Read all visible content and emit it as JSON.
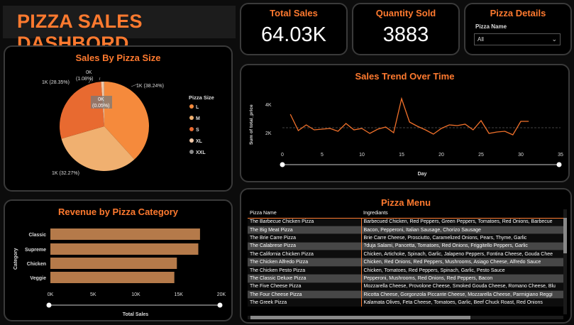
{
  "dashboard": {
    "title": "PIZZA SALES DASHBORD"
  },
  "kpis": {
    "total_sales": {
      "label": "Total Sales",
      "value": "64.03K"
    },
    "quantity_sold": {
      "label": "Quantity Sold",
      "value": "3883"
    }
  },
  "filter": {
    "title": "Pizza Details",
    "field_label": "Pizza Name",
    "selected": "All"
  },
  "size_chart": {
    "title": "Sales By Pizza Size",
    "legend_title": "Pizza Size",
    "sizes": [
      "L",
      "M",
      "S",
      "XL",
      "XXL"
    ],
    "slice_labels": {
      "L": "1K (38.24%)",
      "M": "1K (32.27%)",
      "S": "1K (28.35%)",
      "XL_top": "0K",
      "XL_pct": "(1.08%)",
      "XXL_top": "0K",
      "XXL_pct": "(0.05%)"
    },
    "colors": {
      "L": "#f58a3c",
      "M": "#f0b070",
      "S": "#e86a30",
      "XL": "#f2c9a8",
      "XXL": "#888888"
    }
  },
  "trend_chart": {
    "title": "Sales Trend Over Time",
    "ylabel": "Sum of total_price",
    "xlabel": "Day",
    "y_ticks": [
      "2K",
      "4K"
    ],
    "x_ticks": [
      "0",
      "5",
      "10",
      "15",
      "20",
      "25",
      "30",
      "35"
    ]
  },
  "category_chart": {
    "title": "Revenue by Pizza Category",
    "ylabel": "Category",
    "xlabel": "Total Sales",
    "categories": [
      "Classic",
      "Supreme",
      "Chicken",
      "Veggie"
    ],
    "x_ticks": [
      "0K",
      "5K",
      "10K",
      "15K",
      "20K"
    ]
  },
  "menu": {
    "title": "Pizza Menu",
    "columns": [
      "Pizza Name",
      "Ingrediants"
    ],
    "rows": [
      [
        "The Barbecue Chicken Pizza",
        "Barbecued Chicken, Red Peppers, Green Peppers, Tomatoes, Red Onions, Barbecue"
      ],
      [
        "The Big Meat Pizza",
        "Bacon, Pepperoni, Italian Sausage, Chorizo Sausage"
      ],
      [
        "The Brie Carre Pizza",
        "Brie Carre Cheese, Prosciutto, Caramelized Onions, Pears, Thyme, Garlic"
      ],
      [
        "The Calabrese Pizza",
        "?duja Salami, Pancetta, Tomatoes, Red Onions, Friggitello Peppers, Garlic"
      ],
      [
        "The California Chicken Pizza",
        "Chicken, Artichoke, Spinach, Garlic, Jalapeno Peppers, Fontina Cheese, Gouda Chee"
      ],
      [
        "The Chicken Alfredo Pizza",
        "Chicken, Red Onions, Red Peppers, Mushrooms, Asiago Cheese, Alfredo Sauce"
      ],
      [
        "The Chicken Pesto Pizza",
        "Chicken, Tomatoes, Red Peppers, Spinach, Garlic, Pesto Sauce"
      ],
      [
        "The Classic Deluxe Pizza",
        "Pepperoni, Mushrooms, Red Onions, Red Peppers, Bacon"
      ],
      [
        "The Five Cheese Pizza",
        "Mozzarella Cheese, Provolone Cheese, Smoked Gouda Cheese, Romano Cheese, Blu"
      ],
      [
        "The Four Cheese Pizza",
        "Ricotta Cheese, Gorgonzola Piccante Cheese, Mozzarella Cheese, Parmigiano Reggi"
      ],
      [
        "The Greek Pizza",
        "Kalamata Olives, Feta Cheese, Tomatoes, Garlic, Beef Chuck Roast, Red Onions"
      ]
    ]
  },
  "chart_data": [
    {
      "type": "pie",
      "title": "Sales By Pizza Size",
      "categories": [
        "L",
        "M",
        "S",
        "XL",
        "XXL"
      ],
      "values": [
        38.24,
        32.27,
        28.35,
        1.08,
        0.05
      ],
      "legend": "right"
    },
    {
      "type": "line",
      "title": "Sales Trend Over Time",
      "xlabel": "Day",
      "ylabel": "Sum of total_price",
      "x": [
        1,
        2,
        3,
        4,
        5,
        6,
        7,
        8,
        9,
        10,
        11,
        12,
        13,
        14,
        15,
        16,
        17,
        18,
        19,
        20,
        21,
        22,
        23,
        24,
        25,
        26,
        27,
        28,
        29,
        30,
        31
      ],
      "values": [
        3200,
        2050,
        2450,
        2100,
        2150,
        2200,
        2000,
        2550,
        2100,
        2200,
        1850,
        2150,
        2300,
        1900,
        4300,
        2650,
        2350,
        2100,
        1800,
        2200,
        2450,
        2400,
        2500,
        2100,
        2750,
        1850,
        1950,
        2000,
        1750,
        2700,
        2700
      ],
      "xlim": [
        0,
        35
      ],
      "y_ticks": [
        2000,
        4000
      ],
      "reference_line": "dashed average"
    },
    {
      "type": "bar",
      "orientation": "horizontal",
      "title": "Revenue by Pizza Category",
      "xlabel": "Total Sales",
      "ylabel": "Category",
      "categories": [
        "Classic",
        "Supreme",
        "Chicken",
        "Veggie"
      ],
      "values": [
        17500,
        17300,
        14800,
        14500
      ],
      "xlim": [
        0,
        20000
      ]
    }
  ]
}
